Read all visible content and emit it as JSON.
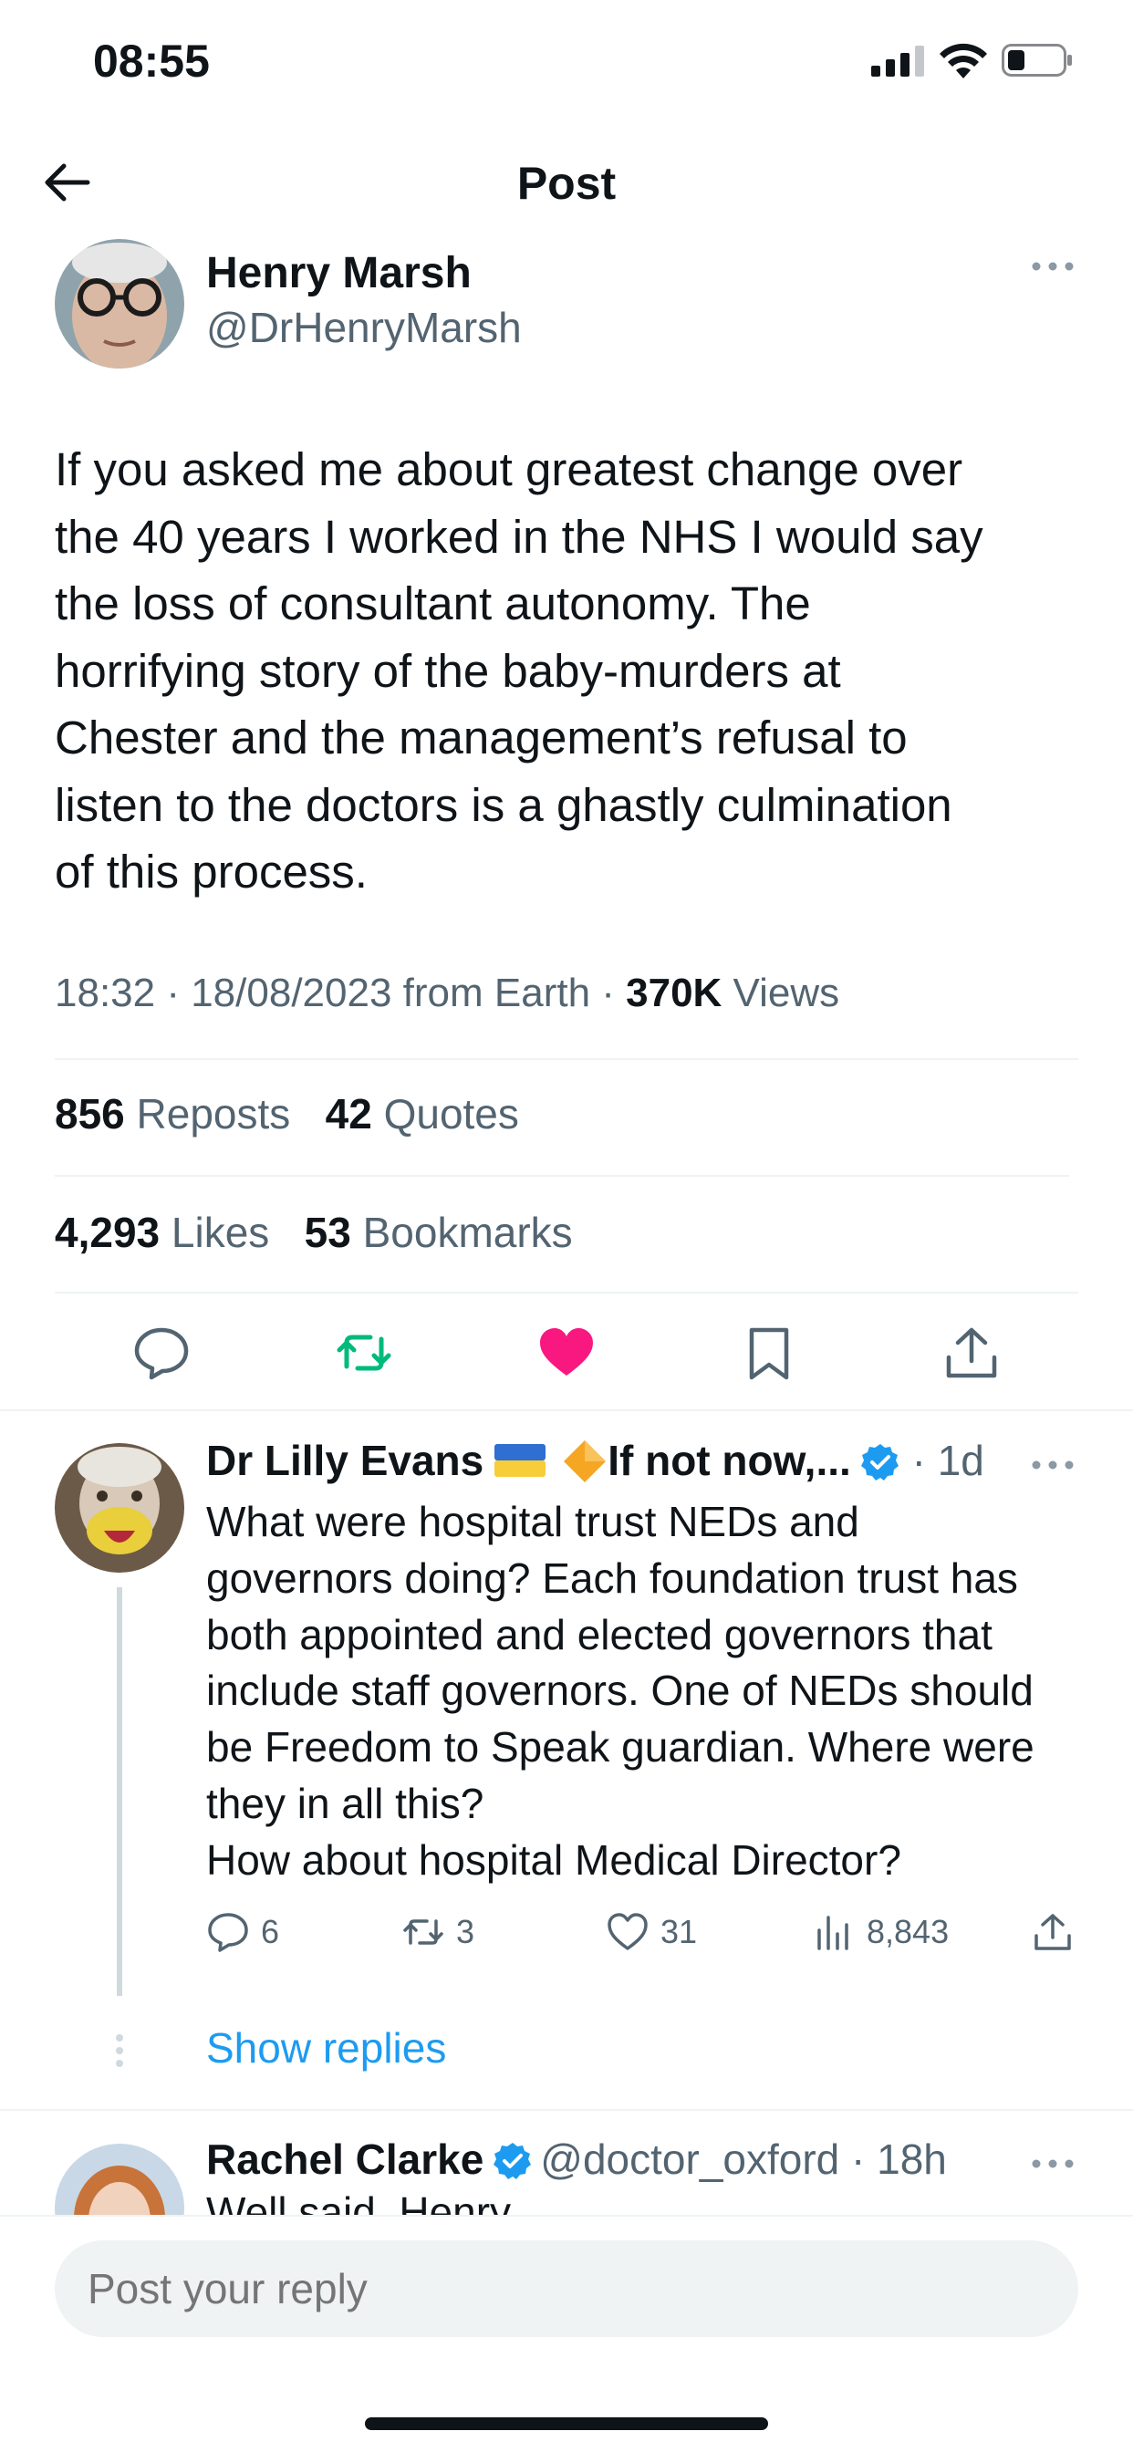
{
  "status": {
    "time": "08:55"
  },
  "header": {
    "title": "Post"
  },
  "post": {
    "author_name": "Henry Marsh",
    "author_handle": "@DrHenryMarsh",
    "text": "If you asked me about greatest change over\nthe 40 years I worked in the NHS I would say\nthe loss of consultant autonomy. The\nhorrifying story of the baby-murders at\nChester  and the management’s refusal to\nlisten to the doctors is a ghastly culmination\nof this process.",
    "meta_time": "18:32 · 18/08/2023 from Earth · ",
    "meta_views_count": "370K",
    "meta_views_label": " Views",
    "reposts_count": "856",
    "reposts_label": "Reposts",
    "quotes_count": "42",
    "quotes_label": "Quotes",
    "likes_count": "4,293",
    "likes_label": "Likes",
    "bookmarks_count": "53",
    "bookmarks_label": "Bookmarks",
    "icons": [
      "comment-icon",
      "repost-icon",
      "heart-filled-icon",
      "bookmark-icon",
      "share-icon"
    ],
    "colors": {
      "repost": "#00ba7c",
      "like": "#f91880"
    }
  },
  "reply": {
    "author_name": "Dr Lilly Evans",
    "author_suffix": "If not now,...",
    "time": " · 1d",
    "text": "What were hospital trust NEDs and\ngovernors doing? Each foundation trust has\nboth appointed and elected governors that\ninclude staff governors. One of NEDs should\nbe Freedom to Speak guardian. Where were\nthey in all this?\nHow about hospital Medical Director?",
    "replies_count": "6",
    "reposts_count": "3",
    "likes_count": "31",
    "views_count": "8,843",
    "show_replies": "Show replies"
  },
  "next_reply": {
    "author_name": "Rachel Clarke",
    "author_handle": "@doctor_oxford",
    "time": " · 18h",
    "text_partial": "Well said, Henry"
  },
  "compose": {
    "placeholder": "Post your reply"
  },
  "colors": {
    "accent": "#1d9bf0",
    "secondary_text": "#536471",
    "divider": "#eff3f4"
  }
}
